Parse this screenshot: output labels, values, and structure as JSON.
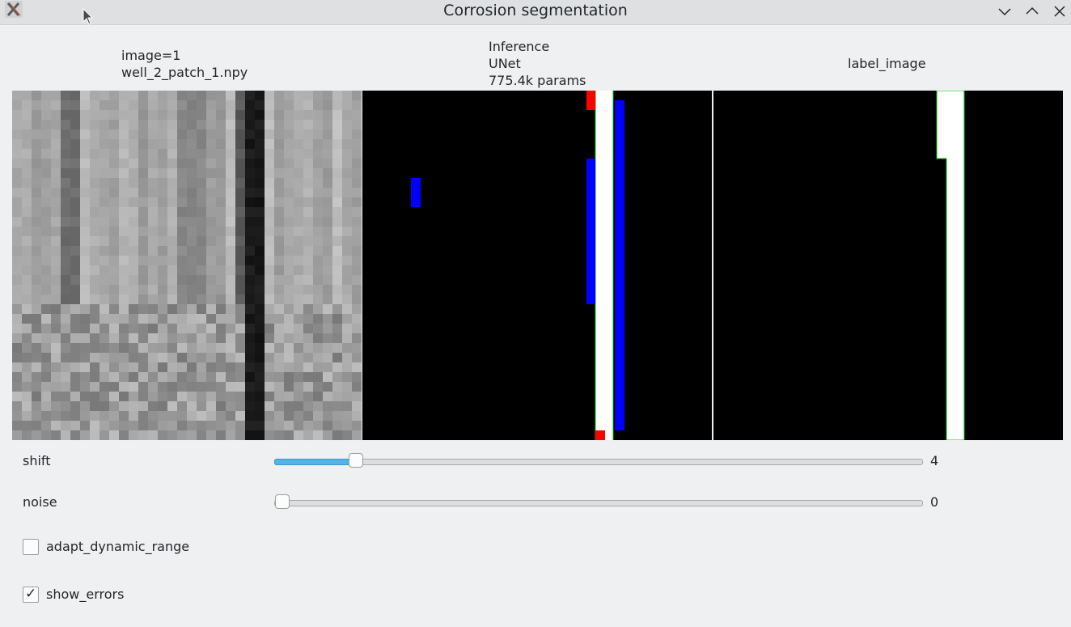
{
  "window": {
    "title": "Corrosion segmentation"
  },
  "icons": {
    "app": "x11-app-icon",
    "minimize": "chevron-down-icon",
    "maximize": "chevron-up-icon",
    "close": "close-icon",
    "cursor": "mouse-pointer-icon"
  },
  "panels": [
    {
      "name": "input-image",
      "lines": [
        "image=1",
        "well_2_patch_1.npy"
      ]
    },
    {
      "name": "inference",
      "lines": [
        "Inference",
        "UNet",
        "775.4k params"
      ]
    },
    {
      "name": "label-image",
      "lines": [
        "label_image"
      ]
    }
  ],
  "controls": {
    "shift": {
      "label": "shift",
      "value": "4",
      "fraction": 0.12
    },
    "noise": {
      "label": "noise",
      "value": "0",
      "fraction": 0.0
    },
    "adapt_dynamic_range": {
      "label": "adapt_dynamic_range",
      "checked": false
    },
    "show_errors": {
      "label": "show_errors",
      "checked": true,
      "mark": "✓"
    }
  },
  "colors": {
    "accent": "#54b3e8",
    "false_positive": "#ff0000",
    "false_negative": "#0000ff",
    "contour": "#00c000"
  }
}
